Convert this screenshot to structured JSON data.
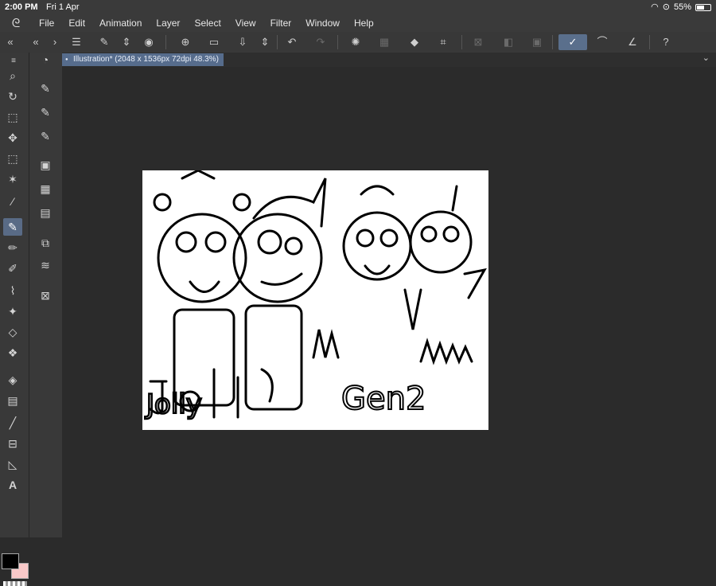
{
  "status_bar": {
    "time": "2:00 PM",
    "date": "Fri 1 Apr",
    "battery": "55%"
  },
  "menu": [
    "File",
    "Edit",
    "Animation",
    "Layer",
    "Select",
    "View",
    "Filter",
    "Window",
    "Help"
  ],
  "document_tab": {
    "label": "Illustration* (2048 x 1536px 72dpi 48.3%)"
  },
  "artwork": {
    "text": "Gen2",
    "text2": "Jolly"
  },
  "colors": {
    "main": "#000000",
    "sub": "#f8c8c8",
    "accent": "#5a6f8c"
  }
}
